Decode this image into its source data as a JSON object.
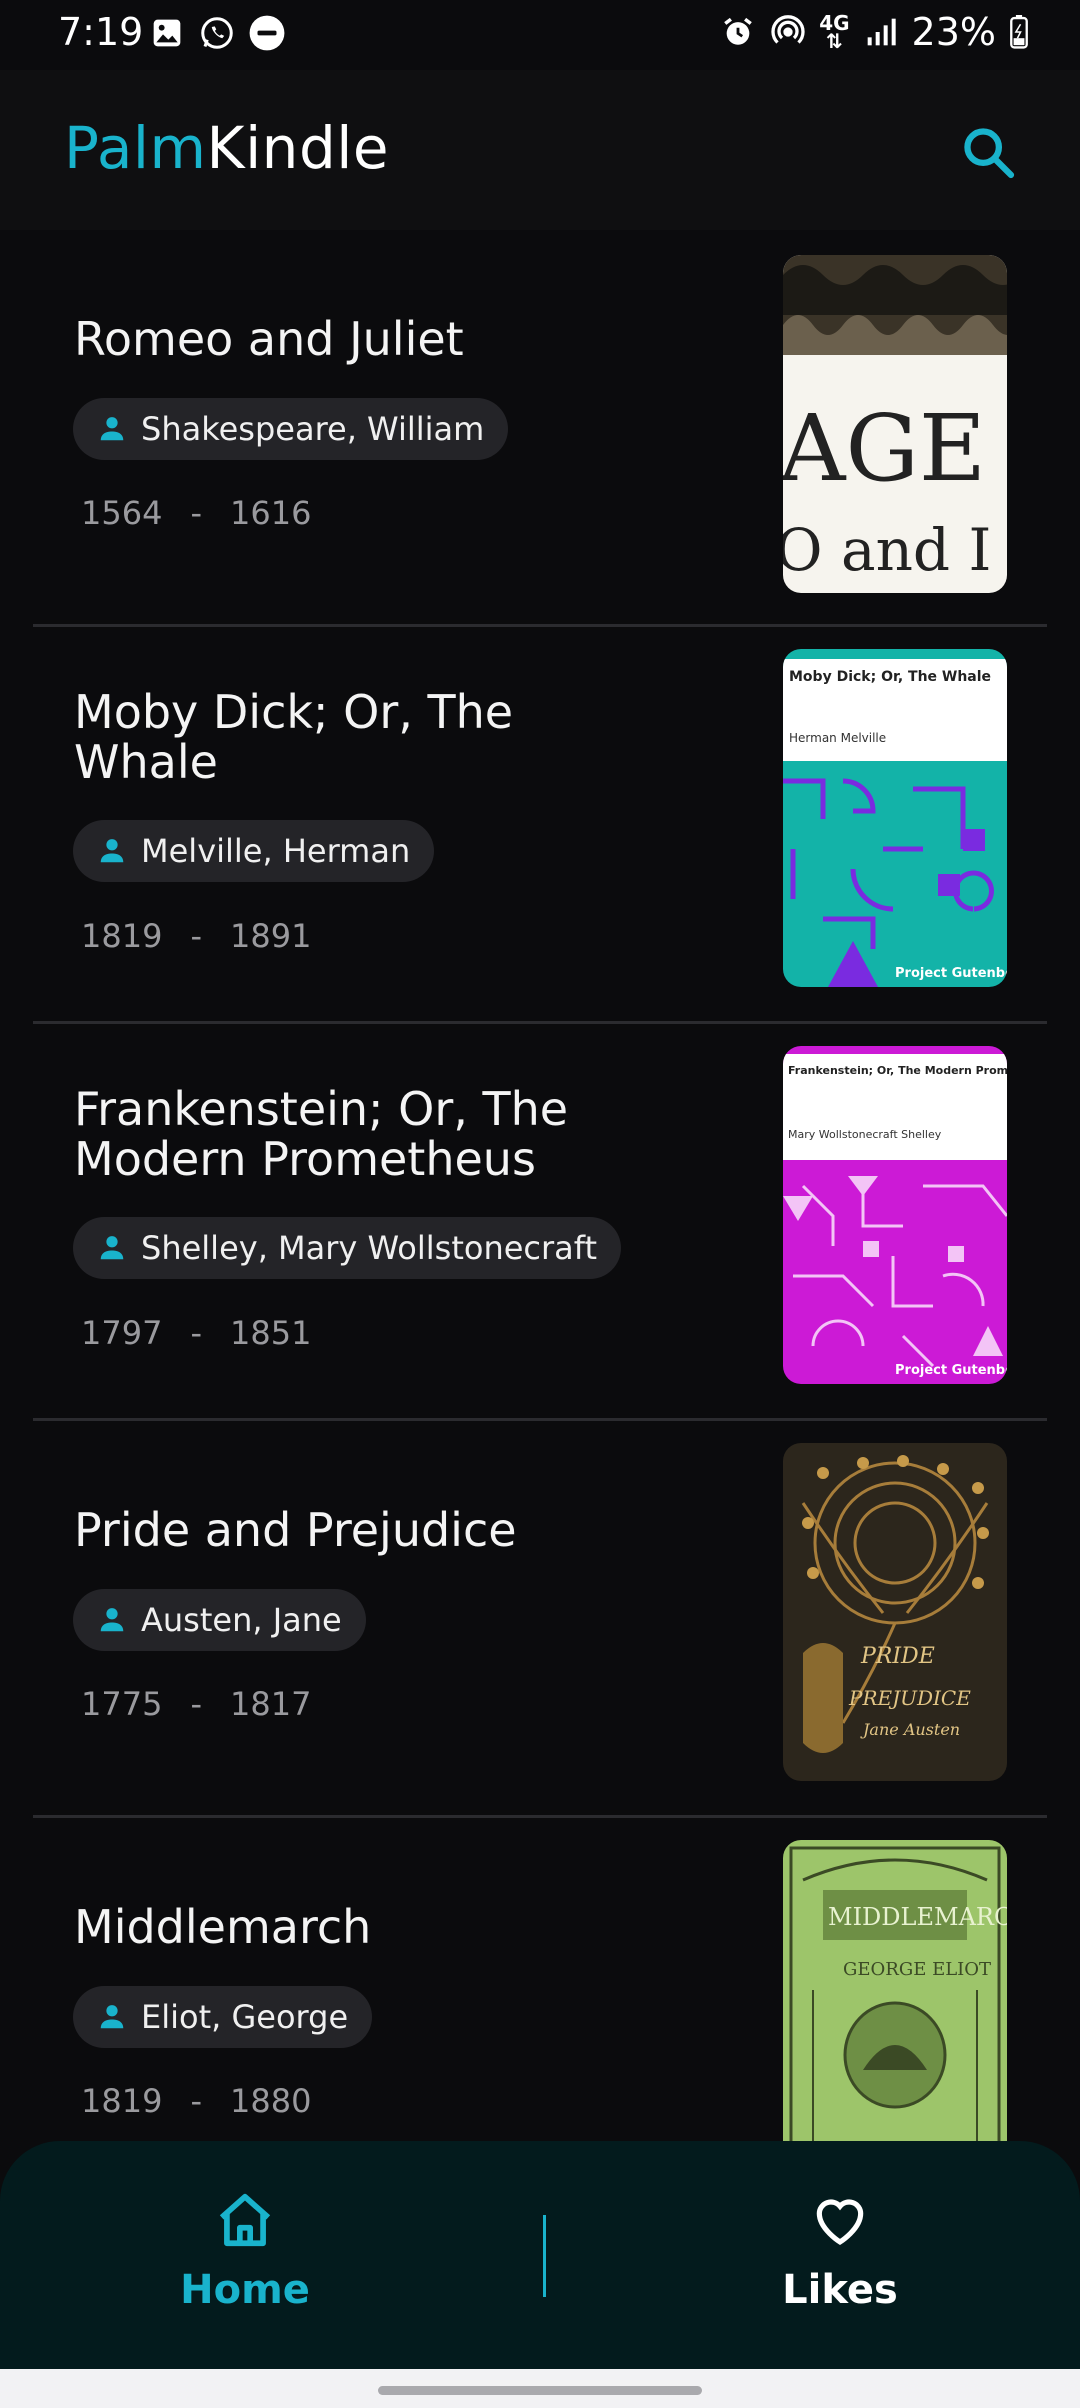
{
  "status_bar": {
    "time": "7:19",
    "network": "4G",
    "battery": "23%",
    "left_icons": [
      "gallery-icon",
      "whatsapp-icon",
      "do-not-disturb-icon"
    ],
    "right_icons": [
      "alarm-icon",
      "hotspot-icon",
      "4g-data-icon",
      "signal-icon",
      "battery-icon"
    ]
  },
  "app_bar": {
    "brand_part1": "Palm",
    "brand_part2": "Kindle",
    "search_icon": "search-icon",
    "accent_color": "#19b3cc"
  },
  "books": [
    {
      "title": "Romeo and Juliet",
      "author": "Shakespeare, William",
      "birth": "1564",
      "death": "1616",
      "separator": "-",
      "cover": "romeo-and-juliet-cover"
    },
    {
      "title": "Moby Dick; Or, The Whale",
      "author": "Melville, Herman",
      "birth": "1819",
      "death": "1891",
      "separator": "-",
      "cover": "moby-dick-cover",
      "cover_title": "Moby Dick; Or, The Whale",
      "cover_author": "Herman Melville",
      "cover_footer": "Project Gutenberg"
    },
    {
      "title": "Frankenstein; Or, The Modern Prometheus",
      "author": "Shelley, Mary Wollstonecraft",
      "birth": "1797",
      "death": "1851",
      "separator": "-",
      "cover": "frankenstein-cover",
      "cover_title": "Frankenstein; Or, The Modern Prometheus",
      "cover_author": "Mary Wollstonecraft Shelley",
      "cover_footer": "Project Gutenberg"
    },
    {
      "title": "Pride and Prejudice",
      "author": "Austen, Jane",
      "birth": "1775",
      "death": "1817",
      "separator": "-",
      "cover": "pride-and-prejudice-cover"
    },
    {
      "title": "Middlemarch",
      "author": "Eliot, George",
      "birth": "1819",
      "death": "1880",
      "separator": "-",
      "cover": "middlemarch-cover"
    }
  ],
  "bottom_nav": {
    "items": [
      {
        "label": "Home",
        "icon": "home-icon",
        "active": true
      },
      {
        "label": "Likes",
        "icon": "heart-icon",
        "active": false
      }
    ]
  }
}
